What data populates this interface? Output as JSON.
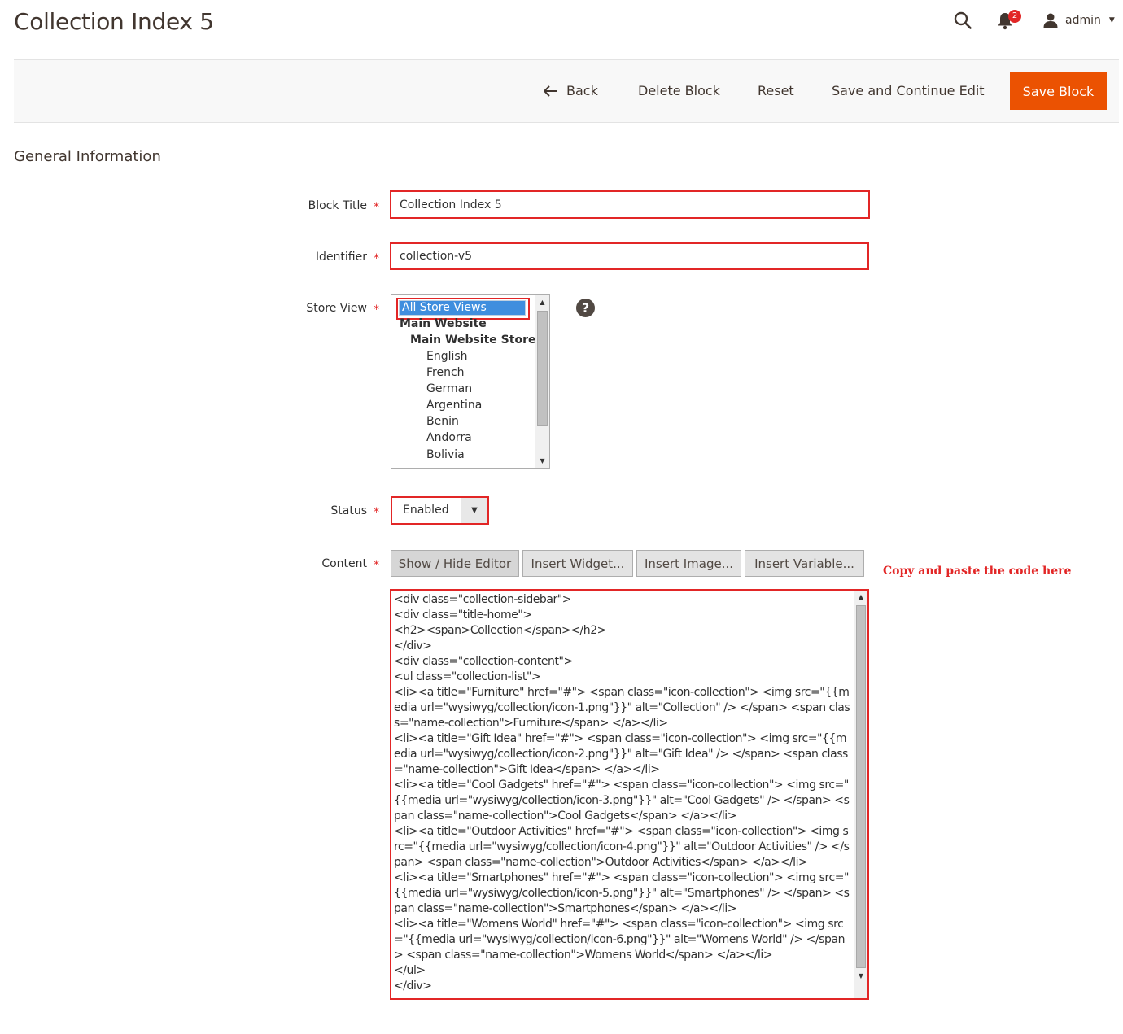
{
  "page": {
    "title": "Collection Index 5"
  },
  "header": {
    "notification_count": "2",
    "user_name": "admin"
  },
  "toolbar": {
    "back_label": "Back",
    "delete_label": "Delete Block",
    "reset_label": "Reset",
    "save_continue_label": "Save and Continue Edit",
    "save_label": "Save Block"
  },
  "section": {
    "title": "General Information"
  },
  "form": {
    "block_title": {
      "label": "Block Title",
      "value": "Collection Index 5"
    },
    "identifier": {
      "label": "Identifier",
      "value": "collection-v5"
    },
    "store_view": {
      "label": "Store View",
      "options": [
        "All Store Views",
        "Main Website",
        "Main Website Store",
        "English",
        "French",
        "German",
        "Argentina",
        "Benin",
        "Andorra",
        "Bolivia"
      ],
      "selected": "All Store Views"
    },
    "status": {
      "label": "Status",
      "value": "Enabled"
    },
    "content": {
      "label": "Content",
      "buttons": [
        "Show / Hide Editor",
        "Insert Widget...",
        "Insert Image...",
        "Insert Variable..."
      ],
      "note": "Copy and paste the code here",
      "code": "<div class=\"collection-sidebar\">\n<div class=\"title-home\">\n<h2><span>Collection</span></h2>\n</div>\n<div class=\"collection-content\">\n<ul class=\"collection-list\">\n<li><a title=\"Furniture\" href=\"#\"> <span class=\"icon-collection\"> <img src=\"{{media url=\"wysiwyg/collection/icon-1.png\"}}\" alt=\"Collection\" /> </span> <span class=\"name-collection\">Furniture</span> </a></li>\n<li><a title=\"Gift Idea\" href=\"#\"> <span class=\"icon-collection\"> <img src=\"{{media url=\"wysiwyg/collection/icon-2.png\"}}\" alt=\"Gift Idea\" /> </span> <span class=\"name-collection\">Gift Idea</span> </a></li>\n<li><a title=\"Cool Gadgets\" href=\"#\"> <span class=\"icon-collection\"> <img src=\"{{media url=\"wysiwyg/collection/icon-3.png\"}}\" alt=\"Cool Gadgets\" /> </span> <span class=\"name-collection\">Cool Gadgets</span> </a></li>\n<li><a title=\"Outdoor Activities\" href=\"#\"> <span class=\"icon-collection\"> <img src=\"{{media url=\"wysiwyg/collection/icon-4.png\"}}\" alt=\"Outdoor Activities\" /> </span> <span class=\"name-collection\">Outdoor Activities</span> </a></li>\n<li><a title=\"Smartphones\" href=\"#\"> <span class=\"icon-collection\"> <img src=\"{{media url=\"wysiwyg/collection/icon-5.png\"}}\" alt=\"Smartphones\" /> </span> <span class=\"name-collection\">Smartphones</span> </a></li>\n<li><a title=\"Womens World\" href=\"#\"> <span class=\"icon-collection\"> <img src=\"{{media url=\"wysiwyg/collection/icon-6.png\"}}\" alt=\"Womens World\" /> </span> <span class=\"name-collection\">Womens World</span> </a></li>\n</ul>\n</div>"
    }
  },
  "colors": {
    "primary_button": "#eb5202",
    "error_outline": "#e22626",
    "selection": "#3f8ede"
  },
  "icons": [
    "search-icon",
    "bell-icon",
    "user-icon",
    "caret-down-icon",
    "arrow-left-icon",
    "help-icon",
    "chevron-down-icon",
    "scroll-up-icon",
    "scroll-down-icon"
  ]
}
